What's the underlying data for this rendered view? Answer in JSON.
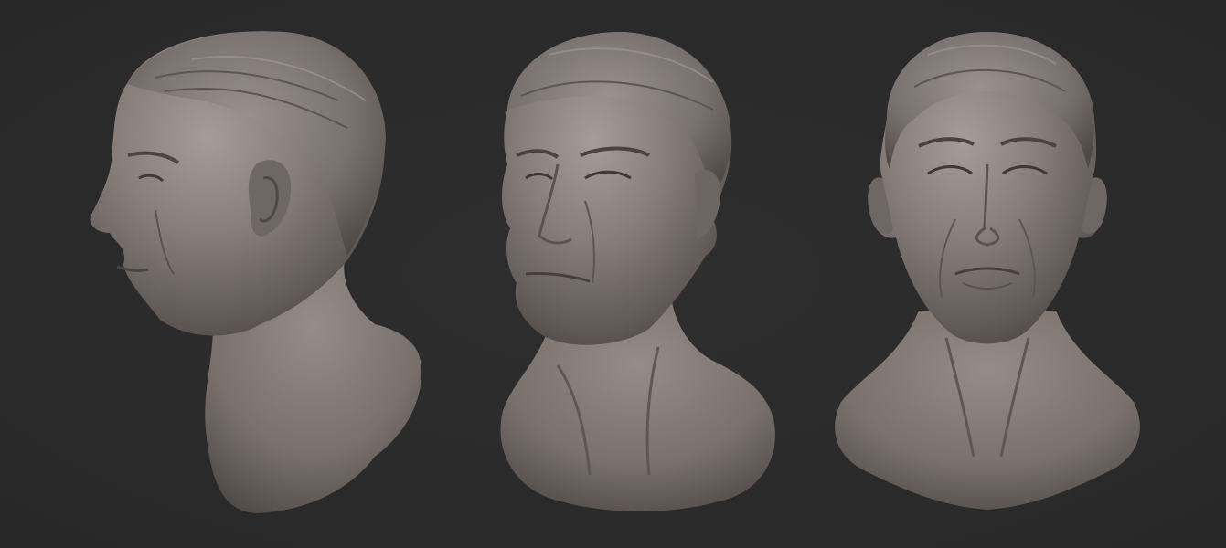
{
  "scene": {
    "background": "#2b2b2b",
    "clay_color": "#857c78",
    "views": [
      {
        "name": "profile-left"
      },
      {
        "name": "three-quarter-left"
      },
      {
        "name": "front"
      }
    ]
  }
}
